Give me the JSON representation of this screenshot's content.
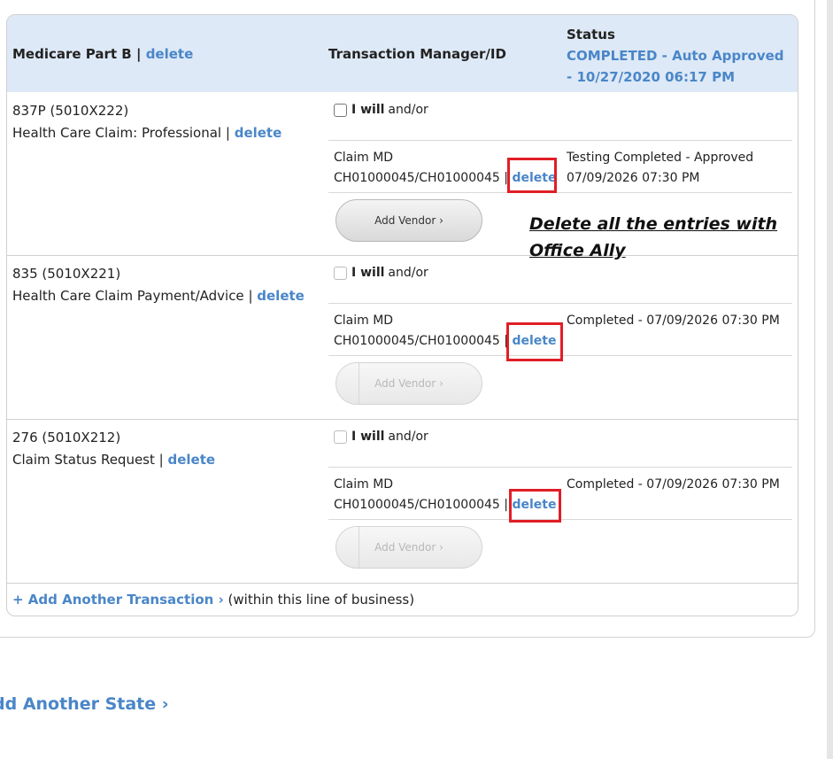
{
  "header": {
    "line_of_business": "Medicare Part B",
    "separator": "|",
    "delete_label": "delete",
    "transaction_manager_heading": "Transaction Manager/ID",
    "status_heading": "Status",
    "status_value": "COMPLETED - Auto Approved - 10/27/2020 06:17 PM"
  },
  "transactions": [
    {
      "code": "837P (5010X222)",
      "name": "Health Care Claim: Professional",
      "delete_label": "delete",
      "i_will": "I will",
      "and_or": "and/or",
      "vendor": "Claim MD",
      "vendor_id": "CH01000045/CH01000045",
      "vendor_delete": "delete",
      "vendor_status_line1": "Testing Completed - Approved",
      "vendor_status_line2": "07/09/2026 07:30 PM",
      "add_vendor_label": "Add Vendor ›"
    },
    {
      "code": "835 (5010X221)",
      "name": "Health Care Claim Payment/Advice",
      "delete_label": "delete",
      "i_will": "I will",
      "and_or": "and/or",
      "vendor": "Claim MD",
      "vendor_id": "CH01000045/CH01000045",
      "vendor_delete": "delete",
      "vendor_status_line1": "Completed - 07/09/2026 07:30 PM",
      "add_vendor_label": "Add Vendor ›"
    },
    {
      "code": "276 (5010X212)",
      "name": "Claim Status Request",
      "delete_label": "delete",
      "i_will": "I will",
      "and_or": "and/or",
      "vendor": "Claim MD",
      "vendor_id": "CH01000045/CH01000045",
      "vendor_delete": "delete",
      "vendor_status_line1": "Completed - 07/09/2026 07:30 PM",
      "add_vendor_label": "Add Vendor ›"
    }
  ],
  "annotation": "Delete all the entries with Office Ally",
  "add_transaction": {
    "link": "+ Add Another Transaction ›",
    "suffix": "(within this line of business)"
  },
  "add_state_label": "dd Another State ›",
  "colors": {
    "link": "#4a86c8",
    "header_bg": "#dde9f6",
    "highlight": "#e01e26"
  }
}
